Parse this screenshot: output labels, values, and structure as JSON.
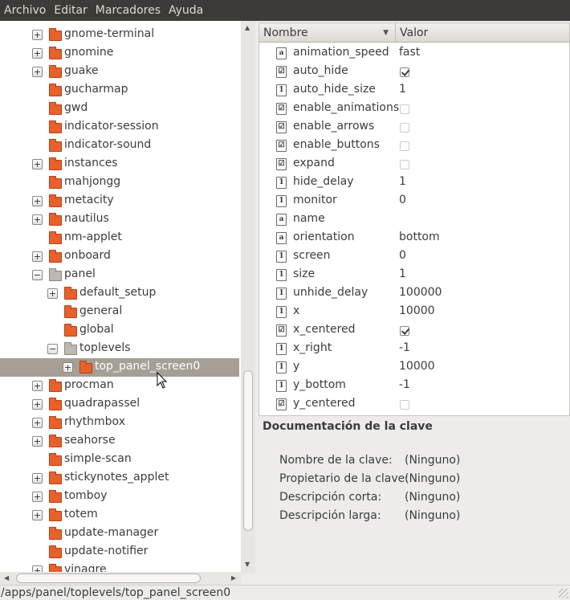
{
  "menubar": [
    "Archivo",
    "Editar",
    "Marcadores",
    "Ayuda"
  ],
  "tree": [
    {
      "label": "gnome-terminal",
      "level": 0,
      "expander": "+",
      "open": false,
      "selected": false
    },
    {
      "label": "gnomine",
      "level": 0,
      "expander": "+",
      "open": false,
      "selected": false
    },
    {
      "label": "guake",
      "level": 0,
      "expander": "+",
      "open": false,
      "selected": false
    },
    {
      "label": "gucharmap",
      "level": 0,
      "expander": "",
      "open": false,
      "selected": false
    },
    {
      "label": "gwd",
      "level": 0,
      "expander": "",
      "open": false,
      "selected": false
    },
    {
      "label": "indicator-session",
      "level": 0,
      "expander": "",
      "open": false,
      "selected": false
    },
    {
      "label": "indicator-sound",
      "level": 0,
      "expander": "",
      "open": false,
      "selected": false
    },
    {
      "label": "instances",
      "level": 0,
      "expander": "+",
      "open": false,
      "selected": false
    },
    {
      "label": "mahjongg",
      "level": 0,
      "expander": "",
      "open": false,
      "selected": false
    },
    {
      "label": "metacity",
      "level": 0,
      "expander": "+",
      "open": false,
      "selected": false
    },
    {
      "label": "nautilus",
      "level": 0,
      "expander": "+",
      "open": false,
      "selected": false
    },
    {
      "label": "nm-applet",
      "level": 0,
      "expander": "",
      "open": false,
      "selected": false
    },
    {
      "label": "onboard",
      "level": 0,
      "expander": "+",
      "open": false,
      "selected": false
    },
    {
      "label": "panel",
      "level": 0,
      "expander": "−",
      "open": true,
      "selected": false
    },
    {
      "label": "default_setup",
      "level": 1,
      "expander": "+",
      "open": false,
      "selected": false
    },
    {
      "label": "general",
      "level": 1,
      "expander": "",
      "open": false,
      "selected": false
    },
    {
      "label": "global",
      "level": 1,
      "expander": "",
      "open": false,
      "selected": false
    },
    {
      "label": "toplevels",
      "level": 1,
      "expander": "−",
      "open": true,
      "selected": false
    },
    {
      "label": "top_panel_screen0",
      "level": 2,
      "expander": "+",
      "open": false,
      "selected": true
    },
    {
      "label": "procman",
      "level": 0,
      "expander": "+",
      "open": false,
      "selected": false
    },
    {
      "label": "quadrapassel",
      "level": 0,
      "expander": "+",
      "open": false,
      "selected": false
    },
    {
      "label": "rhythmbox",
      "level": 0,
      "expander": "+",
      "open": false,
      "selected": false
    },
    {
      "label": "seahorse",
      "level": 0,
      "expander": "+",
      "open": false,
      "selected": false
    },
    {
      "label": "simple-scan",
      "level": 0,
      "expander": "",
      "open": false,
      "selected": false
    },
    {
      "label": "stickynotes_applet",
      "level": 0,
      "expander": "+",
      "open": false,
      "selected": false
    },
    {
      "label": "tomboy",
      "level": 0,
      "expander": "+",
      "open": false,
      "selected": false
    },
    {
      "label": "totem",
      "level": 0,
      "expander": "+",
      "open": false,
      "selected": false
    },
    {
      "label": "update-manager",
      "level": 0,
      "expander": "",
      "open": false,
      "selected": false
    },
    {
      "label": "update-notifier",
      "level": 0,
      "expander": "",
      "open": false,
      "selected": false
    },
    {
      "label": "vinagre",
      "level": 0,
      "expander": "+",
      "open": false,
      "selected": false
    }
  ],
  "keys_header": {
    "name": "Nombre",
    "value": "Valor"
  },
  "keys": [
    {
      "name": "animation_speed",
      "type": "string",
      "icon": "a",
      "value": "fast"
    },
    {
      "name": "auto_hide",
      "type": "bool",
      "icon": "☑",
      "checked": true
    },
    {
      "name": "auto_hide_size",
      "type": "int",
      "icon": "1",
      "value": "1"
    },
    {
      "name": "enable_animations",
      "type": "bool",
      "icon": "☑",
      "checked": false
    },
    {
      "name": "enable_arrows",
      "type": "bool",
      "icon": "☑",
      "checked": false
    },
    {
      "name": "enable_buttons",
      "type": "bool",
      "icon": "☑",
      "checked": false
    },
    {
      "name": "expand",
      "type": "bool",
      "icon": "☑",
      "checked": false
    },
    {
      "name": "hide_delay",
      "type": "int",
      "icon": "1",
      "value": "1"
    },
    {
      "name": "monitor",
      "type": "int",
      "icon": "1",
      "value": "0"
    },
    {
      "name": "name",
      "type": "string",
      "icon": "a",
      "value": ""
    },
    {
      "name": "orientation",
      "type": "string",
      "icon": "a",
      "value": "bottom"
    },
    {
      "name": "screen",
      "type": "int",
      "icon": "1",
      "value": "0"
    },
    {
      "name": "size",
      "type": "int",
      "icon": "1",
      "value": "1"
    },
    {
      "name": "unhide_delay",
      "type": "int",
      "icon": "1",
      "value": "100000"
    },
    {
      "name": "x",
      "type": "int",
      "icon": "1",
      "value": "10000"
    },
    {
      "name": "x_centered",
      "type": "bool",
      "icon": "☑",
      "checked": true
    },
    {
      "name": "x_right",
      "type": "int",
      "icon": "1",
      "value": "-1"
    },
    {
      "name": "y",
      "type": "int",
      "icon": "1",
      "value": "10000"
    },
    {
      "name": "y_bottom",
      "type": "int",
      "icon": "1",
      "value": "-1"
    },
    {
      "name": "y_centered",
      "type": "bool",
      "icon": "☑",
      "checked": false
    }
  ],
  "doc": {
    "title": "Documentación de la clave",
    "rows": [
      {
        "label": "Nombre de la clave:",
        "value": "(Ninguno)"
      },
      {
        "label": "Propietario de la clave:",
        "value": "(Ninguno)"
      },
      {
        "label": "Descripción corta:",
        "value": "(Ninguno)"
      },
      {
        "label": "Descripción larga:",
        "value": "(Ninguno)"
      }
    ]
  },
  "status": "/apps/panel/toplevels/top_panel_screen0"
}
